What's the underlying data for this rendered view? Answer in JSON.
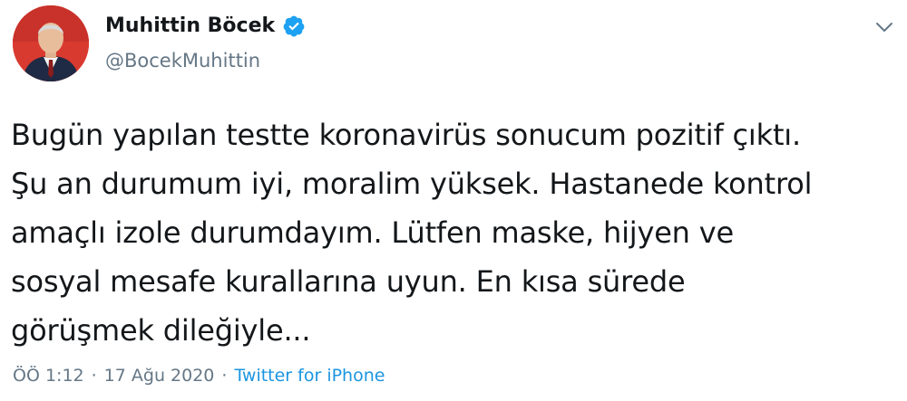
{
  "author": {
    "display_name": "Muhittin Böcek",
    "handle": "@BocekMuhittin",
    "verified": true,
    "avatar_bg": "#d93a2f"
  },
  "tweet": {
    "lines": [
      "Bugün yapılan testte koronavirüs sonucum pozitif çıktı.",
      "Şu an durumum iyi, moralim yüksek. Hastanede kontrol",
      "amaçlı izole durumdayım. Lütfen maske, hijyen ve",
      "sosyal mesafe kurallarına uyun. En kısa sürede",
      "görüşmek dileğiyle..."
    ]
  },
  "meta": {
    "time": "ÖÖ 1:12",
    "separator": "·",
    "date": "17 Ağu 2020",
    "source": "Twitter for iPhone"
  },
  "colors": {
    "text": "#14171a",
    "secondary": "#657786",
    "link": "#1b95e0",
    "verified": "#1da1f2"
  },
  "icons": {
    "verified": "verified-badge-icon",
    "menu": "chevron-down-icon"
  }
}
